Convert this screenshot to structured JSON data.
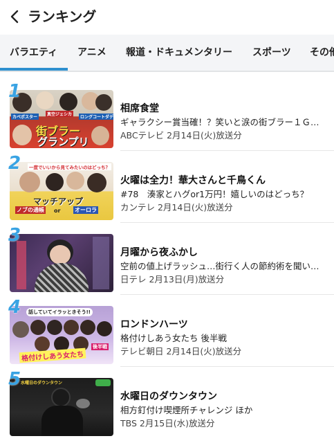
{
  "header": {
    "title": "ランキング"
  },
  "tabs": [
    {
      "label": "バラエティ",
      "selected": true
    },
    {
      "label": "アニメ",
      "selected": false
    },
    {
      "label": "報道・ドキュメンタリー",
      "selected": false
    },
    {
      "label": "スポーツ",
      "selected": false
    },
    {
      "label": "その他",
      "selected": false
    }
  ],
  "colors": {
    "accent": "#2e90cf",
    "rank_number": "#39a3e3"
  },
  "ranking": [
    {
      "rank": "1",
      "title": "相席食堂",
      "description": "ギャラクシー賞当確！？笑いと涙の街ブラー１Ｇ…",
      "meta": "ABCテレビ 2月14日(火)放送分",
      "thumb_texts": [
        "カベポスター",
        "真空ジェシカ",
        "ロングコートダディ",
        "街ブラー",
        "グランプリ"
      ]
    },
    {
      "rank": "2",
      "title": "火曜は全力！華大さんと千鳥くん",
      "description": "#78　湊家とハグor1万円！嬉しいのはどっち？",
      "meta": "カンテレ 2月14日(火)放送分",
      "thumb_texts": [
        "一度でいいから見てみたいのはどっち？",
        "マッチアップ",
        "ノブの通帳",
        "or",
        "オーロラ"
      ]
    },
    {
      "rank": "3",
      "title": "月曜から夜ふかし",
      "description": "空前の値上げラッシュ…街行く人の節約術を聞い…",
      "meta": "日テレ 2月13日(月)放送分",
      "thumb_texts": []
    },
    {
      "rank": "4",
      "title": "ロンドンハーツ",
      "description": "格付けしあう女たち 後半戦",
      "meta": "テレビ朝日 2月14日(火)放送分",
      "thumb_texts": [
        "話していてイラッときそう!!",
        "格付けしあう女たち",
        "後半戦"
      ]
    },
    {
      "rank": "5",
      "title": "水曜日のダウンタウン",
      "description": "相方釘付け喫煙所チャレンジ ほか",
      "meta": "TBS 2月15日(水)放送分",
      "thumb_texts": [
        "水曜日のダウンタウン"
      ]
    }
  ]
}
